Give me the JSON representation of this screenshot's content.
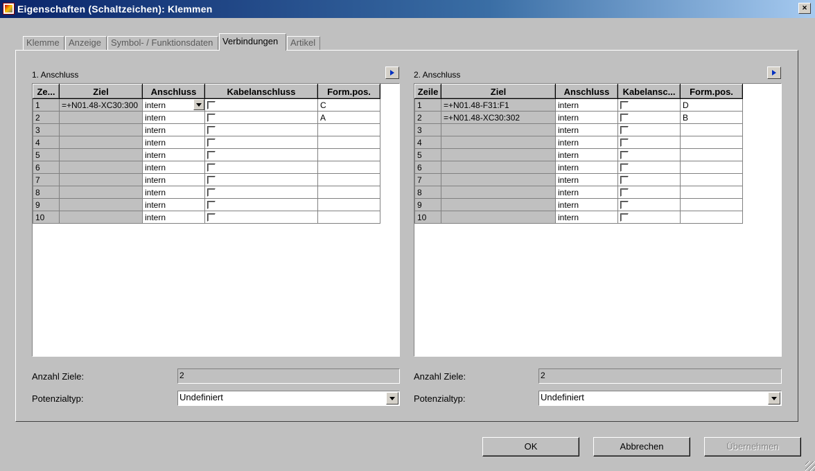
{
  "window": {
    "title": "Eigenschaften (Schaltzeichen): Klemmen",
    "close_glyph": "×"
  },
  "tabs": [
    {
      "label": "Klemme",
      "active": false
    },
    {
      "label": "Anzeige",
      "active": false
    },
    {
      "label": "Symbol- / Funktionsdaten",
      "active": false
    },
    {
      "label": "Verbindungen",
      "active": true
    },
    {
      "label": "Artikel",
      "active": false
    }
  ],
  "left": {
    "title": "1. Anschluss",
    "columns": [
      "Ze...",
      "Ziel",
      "Anschluss",
      "Kabelanschluss",
      "Form.pos."
    ],
    "rows": [
      {
        "num": "1",
        "ziel": "=+N01.48-XC30:300",
        "anschluss": "intern",
        "kabel": false,
        "form": "C"
      },
      {
        "num": "2",
        "ziel": "",
        "anschluss": "intern",
        "kabel": false,
        "form": "A"
      },
      {
        "num": "3",
        "ziel": "",
        "anschluss": "intern",
        "kabel": false,
        "form": ""
      },
      {
        "num": "4",
        "ziel": "",
        "anschluss": "intern",
        "kabel": false,
        "form": ""
      },
      {
        "num": "5",
        "ziel": "",
        "anschluss": "intern",
        "kabel": false,
        "form": ""
      },
      {
        "num": "6",
        "ziel": "",
        "anschluss": "intern",
        "kabel": false,
        "form": ""
      },
      {
        "num": "7",
        "ziel": "",
        "anschluss": "intern",
        "kabel": false,
        "form": ""
      },
      {
        "num": "8",
        "ziel": "",
        "anschluss": "intern",
        "kabel": false,
        "form": ""
      },
      {
        "num": "9",
        "ziel": "",
        "anschluss": "intern",
        "kabel": false,
        "form": ""
      },
      {
        "num": "10",
        "ziel": "",
        "anschluss": "intern",
        "kabel": false,
        "form": ""
      }
    ],
    "anzahl_label": "Anzahl Ziele:",
    "anzahl_value": "2",
    "potenzial_label": "Potenzialtyp:",
    "potenzial_value": "Undefiniert"
  },
  "right": {
    "title": "2. Anschluss",
    "columns": [
      "Zeile",
      "Ziel",
      "Anschluss",
      "Kabelansc...",
      "Form.pos."
    ],
    "rows": [
      {
        "num": "1",
        "ziel": "=+N01.48-F31:F1",
        "anschluss": "intern",
        "kabel": false,
        "form": "D"
      },
      {
        "num": "2",
        "ziel": "=+N01.48-XC30:302",
        "anschluss": "intern",
        "kabel": false,
        "form": "B"
      },
      {
        "num": "3",
        "ziel": "",
        "anschluss": "intern",
        "kabel": false,
        "form": ""
      },
      {
        "num": "4",
        "ziel": "",
        "anschluss": "intern",
        "kabel": false,
        "form": ""
      },
      {
        "num": "5",
        "ziel": "",
        "anschluss": "intern",
        "kabel": false,
        "form": ""
      },
      {
        "num": "6",
        "ziel": "",
        "anschluss": "intern",
        "kabel": false,
        "form": ""
      },
      {
        "num": "7",
        "ziel": "",
        "anschluss": "intern",
        "kabel": false,
        "form": ""
      },
      {
        "num": "8",
        "ziel": "",
        "anschluss": "intern",
        "kabel": false,
        "form": ""
      },
      {
        "num": "9",
        "ziel": "",
        "anschluss": "intern",
        "kabel": false,
        "form": ""
      },
      {
        "num": "10",
        "ziel": "",
        "anschluss": "intern",
        "kabel": false,
        "form": ""
      }
    ],
    "anzahl_label": "Anzahl Ziele:",
    "anzahl_value": "2",
    "potenzial_label": "Potenzialtyp:",
    "potenzial_value": "Undefiniert"
  },
  "buttons": {
    "ok": "OK",
    "cancel": "Abbrechen",
    "apply": "Übernehmen"
  }
}
